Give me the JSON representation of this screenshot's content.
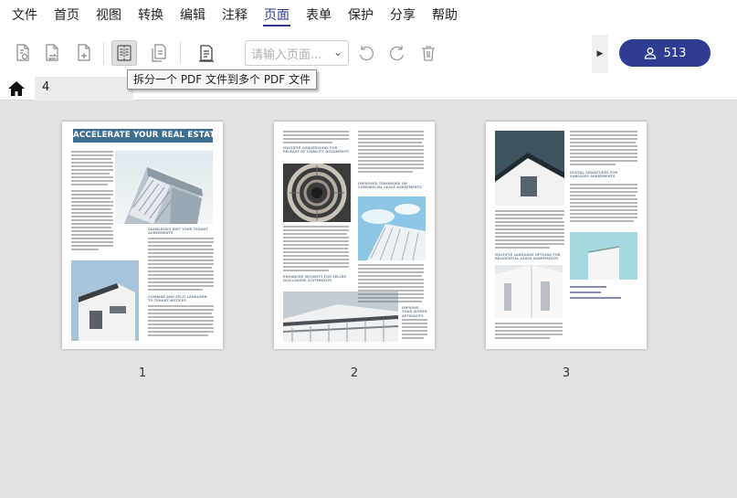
{
  "menu": {
    "items": [
      "文件",
      "首页",
      "视图",
      "转换",
      "编辑",
      "注释",
      "页面",
      "表单",
      "保护",
      "分享",
      "帮助"
    ],
    "active_index": 6
  },
  "toolbar": {
    "buttons": [
      "extract-page-icon",
      "replace-page-icon",
      "insert-page-icon",
      "split-document-icon",
      "merge-page-icon",
      "page-labels-icon",
      "rotate-left-icon",
      "rotate-right-icon",
      "delete-page-icon"
    ],
    "page_select_placeholder": "请输入页面...",
    "tooltip": "拆分一个 PDF 文件到多个 PDF 文件",
    "user_count": "513"
  },
  "tab": {
    "label": "4"
  },
  "pages": {
    "items": [
      {
        "number": "1",
        "title": "ACCELERATE YOUR REAL ESTATE DEALS"
      },
      {
        "number": "2"
      },
      {
        "number": "3"
      }
    ]
  },
  "colors": {
    "accent": "#2e3d92",
    "title_bar": "#3f6e8f",
    "background": "#e2e2e2"
  }
}
